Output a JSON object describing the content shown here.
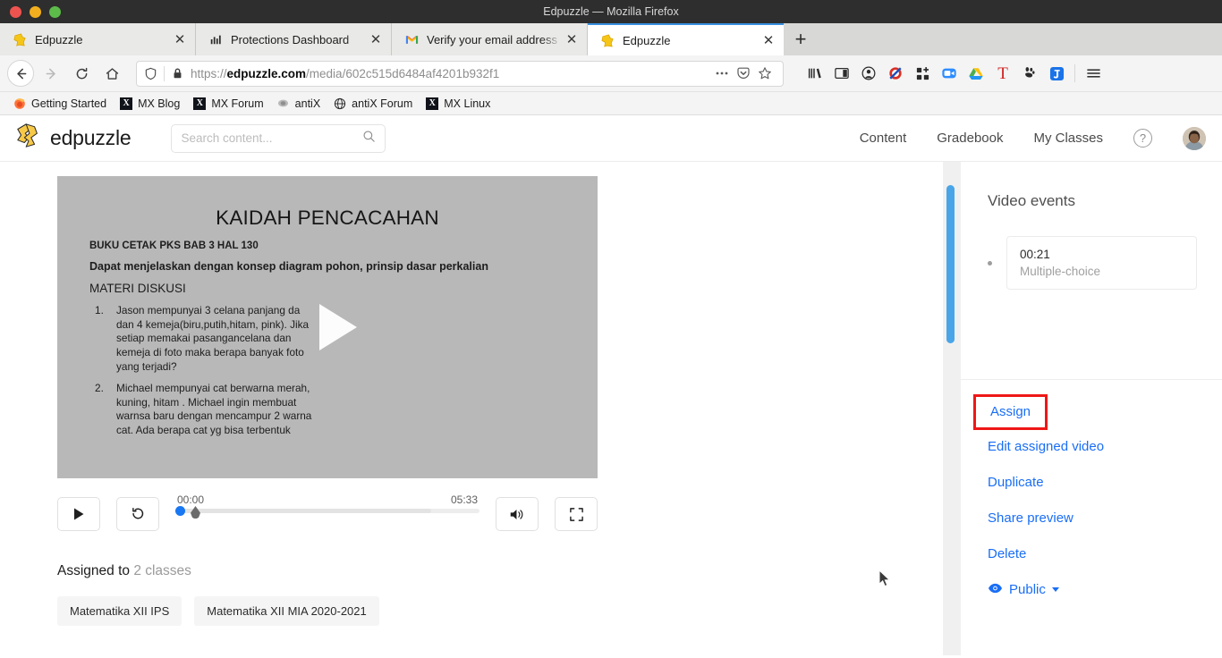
{
  "window": {
    "title": "Edpuzzle — Mozilla Firefox",
    "close_label": "",
    "minimize_label": "",
    "maximize_label": ""
  },
  "browser": {
    "tabs": [
      {
        "title": "Edpuzzle",
        "favicon": "edpuzzle-icon",
        "active": false,
        "close": "✕"
      },
      {
        "title": "Protections Dashboard",
        "favicon": "chart-icon",
        "active": false,
        "close": "✕"
      },
      {
        "title": "Verify your email address",
        "favicon": "gmail-icon",
        "active": false,
        "close": "✕"
      },
      {
        "title": "Edpuzzle",
        "favicon": "edpuzzle-icon",
        "active": true,
        "close": "✕"
      }
    ],
    "new_tab_label": "+",
    "nav": {
      "back": "back-arrow",
      "forward": "forward-arrow",
      "reload": "reload-icon",
      "home": "home-icon"
    },
    "url": {
      "scheme": "https://",
      "domain": "edpuzzle.com",
      "path": "/media/602c515d6484af4201b932f1",
      "full": "https://edpuzzle.com/media/602c515d6484af4201b932f1",
      "shield_icon": "shield-icon",
      "lock_icon": "padlock-icon",
      "page_actions_icon": "ellipsis-icon",
      "pocket_icon": "pocket-icon",
      "bookmark_icon": "star-icon"
    },
    "toolbar_icons": [
      "library-icon",
      "sidebars-icon",
      "account-icon",
      "adblock-icon",
      "extensions-grid-icon",
      "zoom-meeting-icon",
      "google-drive-icon",
      "grammarly-icon",
      "gnome-icon",
      "joplin-icon"
    ],
    "menu_icon": "hamburger-menu-icon",
    "bookmarks": [
      {
        "label": "Getting Started",
        "icon": "firefox-icon"
      },
      {
        "label": "MX Blog",
        "icon": "mx-icon"
      },
      {
        "label": "MX Forum",
        "icon": "mx-icon"
      },
      {
        "label": "antiX",
        "icon": "antix-icon"
      },
      {
        "label": "antiX Forum",
        "icon": "globe-icon"
      },
      {
        "label": "MX Linux",
        "icon": "mx-icon"
      }
    ]
  },
  "app": {
    "brand": "edpuzzle",
    "logo_icon": "edpuzzle-logo-icon",
    "search": {
      "placeholder": "Search content...",
      "value": "",
      "icon": "search-icon"
    },
    "nav_links": [
      "Content",
      "Gradebook",
      "My Classes"
    ],
    "help_label": "?",
    "avatar": "user-avatar"
  },
  "video": {
    "slide": {
      "title": "KAIDAH PENCACAHAN",
      "line1": "BUKU CETAK PKS BAB 3 HAL 130",
      "line2": "Dapat menjelaskan dengan konsep diagram pohon, prinsip dasar perkalian",
      "line3": "MATERI DISKUSI",
      "questions": [
        "Jason mempunyai 3 celana panjang da dan 4 kemeja(biru,putih,hitam, pink). Jika setiap memakai pasangancelana dan kemeja di foto maka berapa banyak foto yang terjadi?",
        "Michael mempunyai cat berwarna merah, kuning, hitam . Michael ingin membuat warnsa baru dengan mencampur 2 warna cat. Ada berapa cat yg bisa terbentuk"
      ]
    },
    "play_overlay_icon": "play-triangle-icon",
    "controls": {
      "play_icon": "play-icon",
      "replay_icon": "replay-icon",
      "current_time": "00:00",
      "duration": "05:33",
      "volume_icon": "volume-icon",
      "fullscreen_icon": "fullscreen-icon",
      "progress_percent": 0,
      "buffered_percent": 84,
      "accent_color": "#1877f2"
    }
  },
  "assigned": {
    "label": "Assigned to",
    "count_text": "2 classes",
    "classes": [
      "Matematika XII IPS",
      "Matematika XII MIA 2020-2021"
    ]
  },
  "sidebar": {
    "events_title": "Video events",
    "events": [
      {
        "time": "00:21",
        "type": "Multiple-choice"
      }
    ],
    "actions": [
      {
        "label": "Assign",
        "highlighted": true
      },
      {
        "label": "Edit assigned video",
        "highlighted": false
      },
      {
        "label": "Duplicate",
        "highlighted": false
      },
      {
        "label": "Share preview",
        "highlighted": false
      },
      {
        "label": "Delete",
        "highlighted": false
      }
    ],
    "visibility": {
      "label": "Public",
      "icon": "eye-icon",
      "caret": "chevron-down-icon"
    },
    "highlight_color": "#ef1717",
    "link_color": "#1a6ef5",
    "scrollbar_color": "#49a5e8"
  }
}
